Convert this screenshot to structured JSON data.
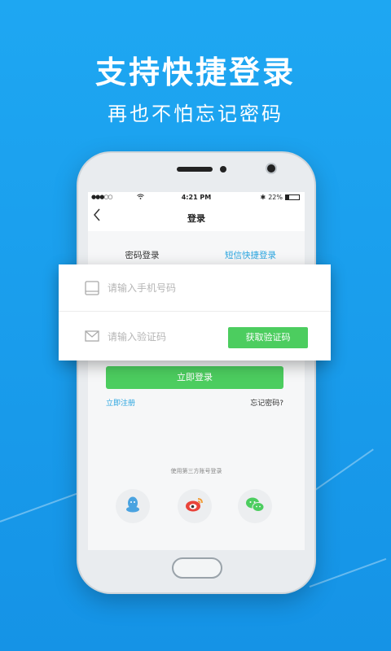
{
  "hero": {
    "title": "支持快捷登录",
    "subtitle": "再也不怕忘记密码"
  },
  "statusbar": {
    "signal": "●●●○○",
    "time": "4:21 PM",
    "bluetooth": "✱",
    "battery": "22%"
  },
  "navbar": {
    "back_icon": "chevron-left-icon",
    "title": "登录"
  },
  "tabs": [
    {
      "label": "密码登录",
      "active": false
    },
    {
      "label": "短信快捷登录",
      "active": true
    }
  ],
  "form": {
    "phone_placeholder": "请输入手机号码",
    "code_placeholder": "请输入验证码",
    "get_code_label": "获取验证码"
  },
  "actions": {
    "login_label": "立即登录",
    "register_label": "立即注册",
    "forgot_label": "忘记密码?"
  },
  "third_party": {
    "label": "使用第三方账号登录",
    "providers": [
      "qq-icon",
      "weibo-icon",
      "wechat-icon"
    ]
  },
  "colors": {
    "background": "#1ea7f2",
    "accent_blue": "#2ca6e0",
    "accent_green": "#4ccd5f"
  }
}
